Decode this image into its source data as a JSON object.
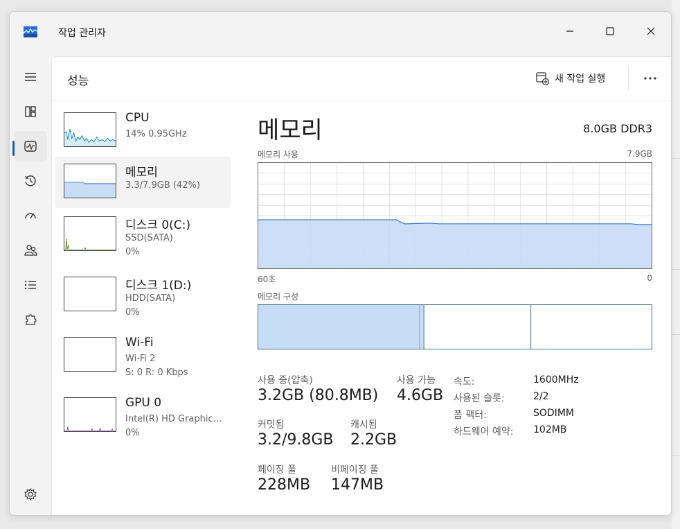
{
  "window": {
    "title": "작업 관리자"
  },
  "nav": {
    "items": [
      {
        "id": "hamburger",
        "icon": "menu-icon"
      },
      {
        "id": "processes",
        "icon": "processes-icon"
      },
      {
        "id": "performance",
        "icon": "performance-icon",
        "active": true
      },
      {
        "id": "app-history",
        "icon": "history-icon"
      },
      {
        "id": "startup-apps",
        "icon": "speedometer-icon"
      },
      {
        "id": "users",
        "icon": "users-icon"
      },
      {
        "id": "details",
        "icon": "list-icon"
      },
      {
        "id": "services",
        "icon": "puzzle-icon"
      },
      {
        "id": "settings",
        "icon": "gear-icon"
      }
    ]
  },
  "header": {
    "title": "성능",
    "run_task_label": "새 작업 실행",
    "more_label": "•••"
  },
  "perf_list": [
    {
      "name": "CPU",
      "sub1": "14% 0.95GHz",
      "sub2": "",
      "selected": false,
      "color": "#118da8"
    },
    {
      "name": "메모리",
      "sub1": "3.3/7.9GB (42%)",
      "sub2": "",
      "selected": true,
      "color": "#1c6fb5"
    },
    {
      "name": "디스크 0(C:)",
      "sub1": "SSD(SATA)",
      "sub2": "0%",
      "selected": false,
      "color": "#6b8e23"
    },
    {
      "name": "디스크 1(D:)",
      "sub1": "HDD(SATA)",
      "sub2": "0%",
      "selected": false,
      "color": "#6b8e23"
    },
    {
      "name": "Wi-Fi",
      "sub1": "Wi-Fi 2",
      "sub2": "S: 0 R: 0 Kbps",
      "selected": false,
      "color": "#a0522d"
    },
    {
      "name": "GPU 0",
      "sub1": "Intel(R) HD Graphic…",
      "sub2": "0%",
      "selected": false,
      "color": "#8a3ea8"
    }
  ],
  "detail": {
    "title": "메모리",
    "spec": "8.0GB DDR3",
    "usage_label": "메모리 사용",
    "usage_max": "7.9GB",
    "time_left": "60초",
    "time_right": "0",
    "composition_label": "메모리 구성",
    "usage_level_fraction": 0.42,
    "composition_fractions": {
      "in_use": 0.41,
      "modified": 0.01,
      "standby": 0.27,
      "free": 0.3
    },
    "stats": {
      "in_use_label": "사용 중(압축)",
      "in_use_value": "3.2GB (80.8MB)",
      "available_label": "사용 가능",
      "available_value": "4.6GB",
      "committed_label": "커밋됨",
      "committed_value": "3.2/9.8GB",
      "cached_label": "캐시됨",
      "cached_value": "2.2GB",
      "paged_label": "페이징 풀",
      "paged_value": "228MB",
      "nonpaged_label": "비페이징 풀",
      "nonpaged_value": "147MB"
    },
    "info": {
      "speed_key": "속도:",
      "speed_val": "1600MHz",
      "slots_key": "사용된 슬롯:",
      "slots_val": "2/2",
      "form_key": "폼 팩터:",
      "form_val": "SODIMM",
      "reserved_key": "하드웨어 예약:",
      "reserved_val": "102MB"
    }
  },
  "colors": {
    "accent": "#1a5fb4",
    "memory_fill": "#c7dcf5",
    "memory_line": "#3a78c2"
  }
}
